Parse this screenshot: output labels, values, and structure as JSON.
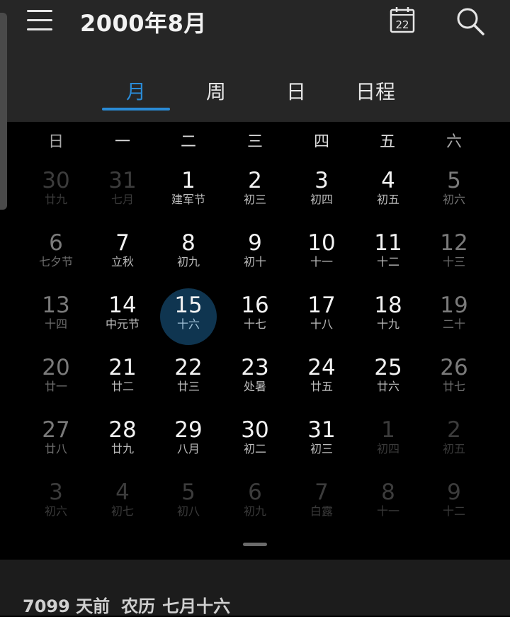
{
  "header": {
    "title": "2000年8月",
    "today_icon_day": "22",
    "icons": {
      "menu": "menu-icon",
      "today": "calendar-today-icon",
      "search": "search-icon"
    }
  },
  "tabs": [
    {
      "label": "月",
      "active": true
    },
    {
      "label": "周",
      "active": false
    },
    {
      "label": "日",
      "active": false
    },
    {
      "label": "日程",
      "active": false
    }
  ],
  "colors": {
    "accent": "#2a8bd6",
    "background": "#000000",
    "topbar": "#262626",
    "selected_circle": "#0f3550"
  },
  "weekdays": [
    "日",
    "一",
    "二",
    "三",
    "四",
    "五",
    "六"
  ],
  "weeks": [
    [
      {
        "day": "30",
        "lunar": "廿九",
        "type": "other"
      },
      {
        "day": "31",
        "lunar": "七月",
        "type": "other"
      },
      {
        "day": "1",
        "lunar": "建军节",
        "type": "cur"
      },
      {
        "day": "2",
        "lunar": "初三",
        "type": "cur"
      },
      {
        "day": "3",
        "lunar": "初四",
        "type": "cur"
      },
      {
        "day": "4",
        "lunar": "初五",
        "type": "cur"
      },
      {
        "day": "5",
        "lunar": "初六",
        "type": "wkend"
      }
    ],
    [
      {
        "day": "6",
        "lunar": "七夕节",
        "type": "wkend"
      },
      {
        "day": "7",
        "lunar": "立秋",
        "type": "cur"
      },
      {
        "day": "8",
        "lunar": "初九",
        "type": "cur"
      },
      {
        "day": "9",
        "lunar": "初十",
        "type": "cur"
      },
      {
        "day": "10",
        "lunar": "十一",
        "type": "cur"
      },
      {
        "day": "11",
        "lunar": "十二",
        "type": "cur"
      },
      {
        "day": "12",
        "lunar": "十三",
        "type": "wkend"
      }
    ],
    [
      {
        "day": "13",
        "lunar": "十四",
        "type": "wkend"
      },
      {
        "day": "14",
        "lunar": "中元节",
        "type": "cur"
      },
      {
        "day": "15",
        "lunar": "十六",
        "type": "selected"
      },
      {
        "day": "16",
        "lunar": "十七",
        "type": "cur"
      },
      {
        "day": "17",
        "lunar": "十八",
        "type": "cur"
      },
      {
        "day": "18",
        "lunar": "十九",
        "type": "cur"
      },
      {
        "day": "19",
        "lunar": "二十",
        "type": "wkend"
      }
    ],
    [
      {
        "day": "20",
        "lunar": "廿一",
        "type": "wkend"
      },
      {
        "day": "21",
        "lunar": "廿二",
        "type": "cur"
      },
      {
        "day": "22",
        "lunar": "廿三",
        "type": "cur"
      },
      {
        "day": "23",
        "lunar": "处暑",
        "type": "cur"
      },
      {
        "day": "24",
        "lunar": "廿五",
        "type": "cur"
      },
      {
        "day": "25",
        "lunar": "廿六",
        "type": "cur"
      },
      {
        "day": "26",
        "lunar": "廿七",
        "type": "wkend"
      }
    ],
    [
      {
        "day": "27",
        "lunar": "廿八",
        "type": "wkend"
      },
      {
        "day": "28",
        "lunar": "廿九",
        "type": "cur"
      },
      {
        "day": "29",
        "lunar": "八月",
        "type": "cur"
      },
      {
        "day": "30",
        "lunar": "初二",
        "type": "cur"
      },
      {
        "day": "31",
        "lunar": "初三",
        "type": "cur"
      },
      {
        "day": "1",
        "lunar": "初四",
        "type": "other"
      },
      {
        "day": "2",
        "lunar": "初五",
        "type": "other"
      }
    ],
    [
      {
        "day": "3",
        "lunar": "初六",
        "type": "other"
      },
      {
        "day": "4",
        "lunar": "初七",
        "type": "other"
      },
      {
        "day": "5",
        "lunar": "初八",
        "type": "other"
      },
      {
        "day": "6",
        "lunar": "初九",
        "type": "other"
      },
      {
        "day": "7",
        "lunar": "白露",
        "type": "other"
      },
      {
        "day": "8",
        "lunar": "十一",
        "type": "other"
      },
      {
        "day": "9",
        "lunar": "十二",
        "type": "other"
      }
    ]
  ],
  "footer": {
    "days_ago": "7099 天前",
    "lunar_label": "农历",
    "lunar_date": "七月十六"
  }
}
